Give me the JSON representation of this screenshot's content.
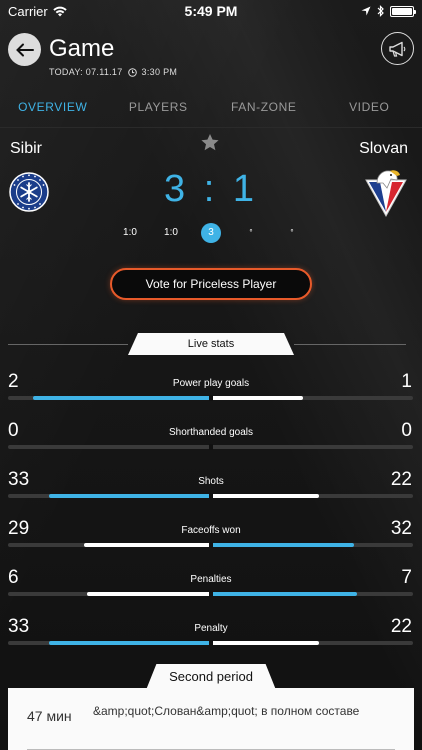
{
  "status_bar": {
    "carrier": "Carrier",
    "time": "5:49 PM"
  },
  "header": {
    "title": "Game",
    "date_text": "TODAY: 07.11.17",
    "time_text": "3:30 PM"
  },
  "tabs": [
    {
      "label": "OVERVIEW",
      "active": true
    },
    {
      "label": "PLAYERS",
      "active": false
    },
    {
      "label": "FAN-ZONE",
      "active": false
    },
    {
      "label": "VIDEO",
      "active": false
    }
  ],
  "match": {
    "home_team": "Sibir",
    "away_team": "Slovan",
    "score": "3 : 1",
    "periods": [
      {
        "label": "1:0",
        "active": false
      },
      {
        "label": "1:0",
        "active": false
      },
      {
        "label": "3",
        "active": true
      },
      {
        "label": "°",
        "active": false
      },
      {
        "label": "°",
        "active": false
      }
    ]
  },
  "vote_button": {
    "label": "Vote for Priceless Player"
  },
  "live_stats": {
    "title": "Live stats",
    "items": [
      {
        "label": "Power play goals",
        "home": "2",
        "away": "1",
        "home_fill": 0.66,
        "away_fill": 0.34,
        "home_color": "blue",
        "away_color": "white"
      },
      {
        "label": "Shorthanded goals",
        "home": "0",
        "away": "0",
        "home_fill": 0,
        "away_fill": 0,
        "home_color": "blue",
        "away_color": "white"
      },
      {
        "label": "Shots",
        "home": "33",
        "away": "22",
        "home_fill": 0.6,
        "away_fill": 0.4,
        "home_color": "blue",
        "away_color": "white"
      },
      {
        "label": "Faceoffs won",
        "home": "29",
        "away": "32",
        "home_fill": 0.47,
        "away_fill": 0.53,
        "home_color": "white",
        "away_color": "blue"
      },
      {
        "label": "Penalties",
        "home": "6",
        "away": "7",
        "home_fill": 0.46,
        "away_fill": 0.54,
        "home_color": "white",
        "away_color": "blue"
      },
      {
        "label": "Penalty",
        "home": "33",
        "away": "22",
        "home_fill": 0.6,
        "away_fill": 0.4,
        "home_color": "blue",
        "away_color": "white"
      }
    ]
  },
  "timeline": {
    "period_title": "Second period",
    "events": [
      {
        "time": "47 мин",
        "text": "&amp;quot;Слован&amp;quot; в полном составе"
      }
    ]
  },
  "colors": {
    "accent": "#3fb3e6",
    "vote_border": "#e85a2a",
    "background": "#141414"
  }
}
